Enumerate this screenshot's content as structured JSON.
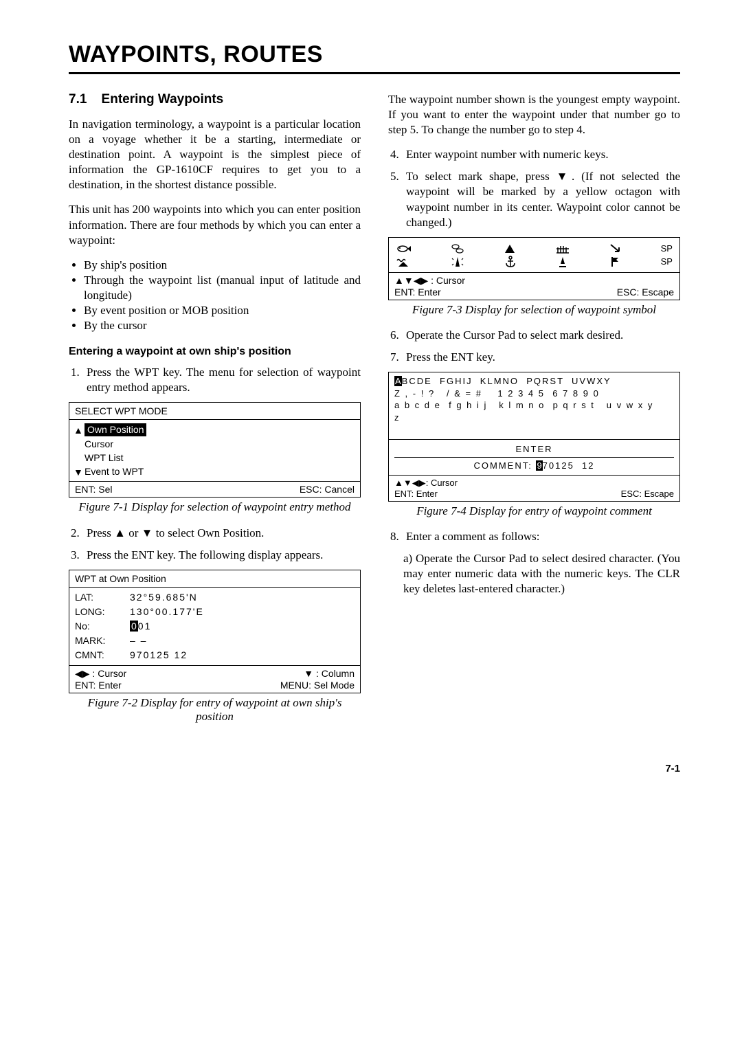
{
  "title": "WAYPOINTS, ROUTES",
  "section": {
    "num": "7.1",
    "heading": "Entering Waypoints"
  },
  "para1": "In navigation terminology, a waypoint is a particular location on a voyage whether it be a starting, intermediate or destination point. A waypoint is the simplest piece of information the GP-1610CF requires to get you to a destination, in the shortest distance possible.",
  "para2": "This unit has 200 waypoints into which you can enter position information. There are four methods by which you can enter a waypoint:",
  "bullets": [
    "By ship's position",
    "Through the waypoint list (manual input of latitude and longitude)",
    "By event position or MOB position",
    "By the cursor"
  ],
  "subhead1": "Entering a waypoint at own ship's position",
  "step1": "Press the WPT key. The menu for selection of waypoint entry method appears.",
  "fig71": {
    "title": "SELECT WPT MODE",
    "items": [
      "Own Position",
      "Cursor",
      "WPT List",
      "Event to WPT"
    ],
    "ent": "ENT: Sel",
    "esc": "ESC: Cancel",
    "caption": "Figure 7-1 Display for selection of waypoint entry method"
  },
  "step2": "Press ▲ or ▼ to select Own Position.",
  "step3": "Press the ENT key. The following display appears.",
  "fig72": {
    "title": "WPT at Own Position",
    "lat_k": "LAT:",
    "lat_v": "32°59.685'N",
    "long_k": "LONG:",
    "long_v": "130°00.177'E",
    "no_k": "No:",
    "no_hi": "0",
    "no_rest": "01",
    "mark_k": "MARK:",
    "mark_v": "– –",
    "cmnt_k": "CMNT:",
    "cmnt_v": "970125 12",
    "f1a": "◀▶ : Cursor",
    "f1b": "▼ : Column",
    "f2a": "ENT: Enter",
    "f2b": "MENU: Sel Mode",
    "caption": "Figure 7-2 Display for entry of waypoint at own ship's position"
  },
  "colR_intro": "The waypoint number shown is the youngest empty waypoint. If you want to enter the waypoint under that number go to step 5. To change the number go to step 4.",
  "step4": "Enter waypoint number with numeric keys.",
  "step5": "To select mark shape, press ▼. (If not selected the waypoint will be marked by a yellow octagon with waypoint number in its center. Waypoint color cannot be changed.)",
  "fig73": {
    "sp": "SP",
    "cursor": "▲▼◀▶ : Cursor",
    "ent": "ENT: Enter",
    "esc": "ESC: Escape",
    "caption": "Figure 7-3 Display for selection of waypoint symbol"
  },
  "step6": "Operate the Cursor Pad to select mark desired.",
  "step7": "Press the ENT key.",
  "fig74": {
    "row1_hi": "A",
    "row1_rest": "BCDE  FGHIJ  KLMNO  PQRST  UVWXY",
    "row2": "Z , - ! ?   / & = #    1 2 3 4 5  6 7 8 9 0",
    "row3": "a b c d e  f g h i j   k l m n o  p q r s t   u v w x y",
    "row4": "z",
    "enter": "ENTER",
    "comment_label": "COMMENT: ",
    "comment_hi": "9",
    "comment_rest": "70125  12",
    "cursor": "▲▼◀▶: Cursor",
    "ent": "ENT: Enter",
    "esc": "ESC: Escape",
    "caption": "Figure 7-4 Display for entry of waypoint comment"
  },
  "step8": "Enter a comment as follows:",
  "step8a": "a) Operate the Cursor Pad to select desired character. (You may enter numeric data with the numeric keys. The CLR key deletes last-entered character.)",
  "page": "7-1"
}
